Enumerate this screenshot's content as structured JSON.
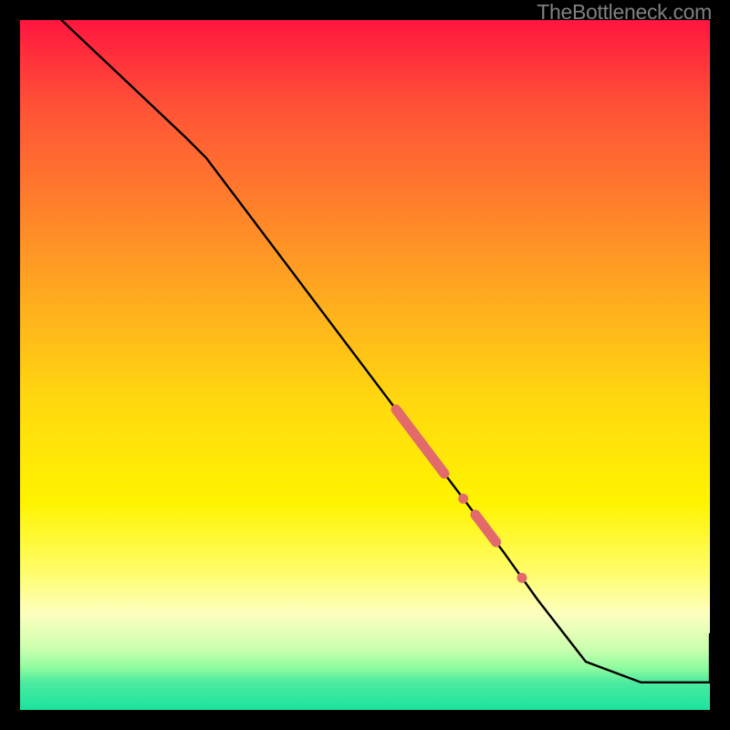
{
  "watermark": "TheBottleneck.com",
  "chart_data": {
    "type": "line",
    "title": "",
    "xlabel": "",
    "ylabel": "",
    "xlim": [
      0,
      100
    ],
    "ylim": [
      0,
      100
    ],
    "series": [
      {
        "name": "curve",
        "x": [
          0,
          6,
          24,
          27,
          70,
          75,
          82,
          90,
          100,
          100
        ],
        "values": [
          105,
          100,
          83,
          80,
          23,
          16,
          7,
          4,
          4,
          11
        ]
      }
    ],
    "markers": [
      {
        "x_start": 54.5,
        "x_end": 61.5,
        "style": "thick"
      },
      {
        "x_start": 64.0,
        "x_end": 64.5,
        "style": "dot"
      },
      {
        "x_start": 66.0,
        "x_end": 69.0,
        "style": "thick"
      },
      {
        "x_start": 72.5,
        "x_end": 73.0,
        "style": "dot"
      }
    ],
    "marker_color": "#e26a6a",
    "line_color": "#000000",
    "grid": false
  }
}
